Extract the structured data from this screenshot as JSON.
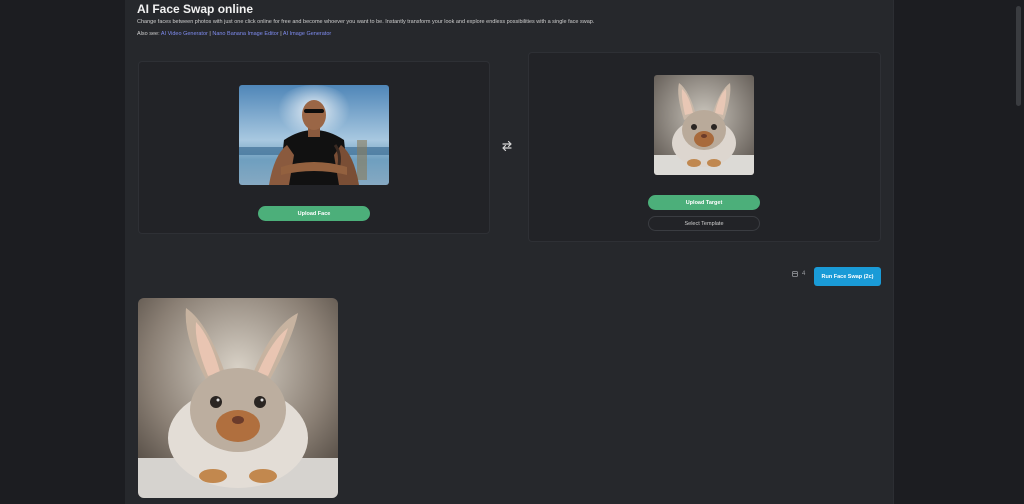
{
  "header": {
    "title": "AI Face Swap online",
    "description": "Change faces between photos with just one click online for free and become whoever you want to be. Instantly transform your look and explore endless possibilities with a single face swap.",
    "also_see_label": "Also see:",
    "links": [
      "AI Video Generator",
      "Nano Banana Image Editor",
      "AI Image Generator"
    ],
    "separator": "|"
  },
  "face_panel": {
    "upload_label": "Upload Face"
  },
  "target_panel": {
    "upload_label": "Upload Target",
    "template_label": "Select Template"
  },
  "run": {
    "credits": "4",
    "label": "Run Face Swap (2c)"
  },
  "colors": {
    "accent_green": "#4caf7a",
    "accent_blue": "#1a9bd7",
    "link": "#7f8cf0"
  },
  "icons": {
    "swap": "swap-arrows-icon",
    "credits": "credit-icon"
  }
}
